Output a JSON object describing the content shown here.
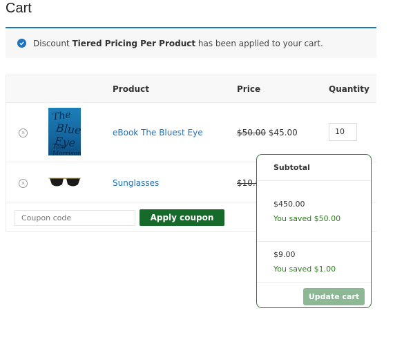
{
  "page": {
    "title": "Cart"
  },
  "notice": {
    "prefix": "Discount ",
    "discount_name": "Tiered Pricing Per Product",
    "suffix": " has been applied to your cart.",
    "icon": "check-circle-icon",
    "accent": "#1e73be"
  },
  "table": {
    "headers": {
      "product": "Product",
      "price": "Price",
      "quantity": "Quantity"
    },
    "rows": [
      {
        "name": "eBook The Bluest Eye",
        "original_price": "$50.00",
        "price": "$45.00",
        "quantity": "10",
        "thumb_title_1": "The",
        "thumb_title_2": "Bluest Eye",
        "thumb_author": "Toni Morrison"
      },
      {
        "name": "Sunglasses",
        "original_price": "$10.0",
        "price": "",
        "quantity": ""
      }
    ]
  },
  "coupon": {
    "placeholder": "Coupon code",
    "apply_label": "Apply coupon"
  },
  "subtotal_popup": {
    "header": "Subtotal",
    "items": [
      {
        "amount": "$450.00",
        "saved": "You saved $50.00"
      },
      {
        "amount": "$9.00",
        "saved": "You saved $1.00"
      }
    ],
    "update_label": "Update cart"
  },
  "colors": {
    "link": "#1e73be",
    "button": "#176b2a",
    "saved": "#2e7d1f",
    "popup_border": "#2a7a3a",
    "update_disabled": "#8cb896"
  }
}
